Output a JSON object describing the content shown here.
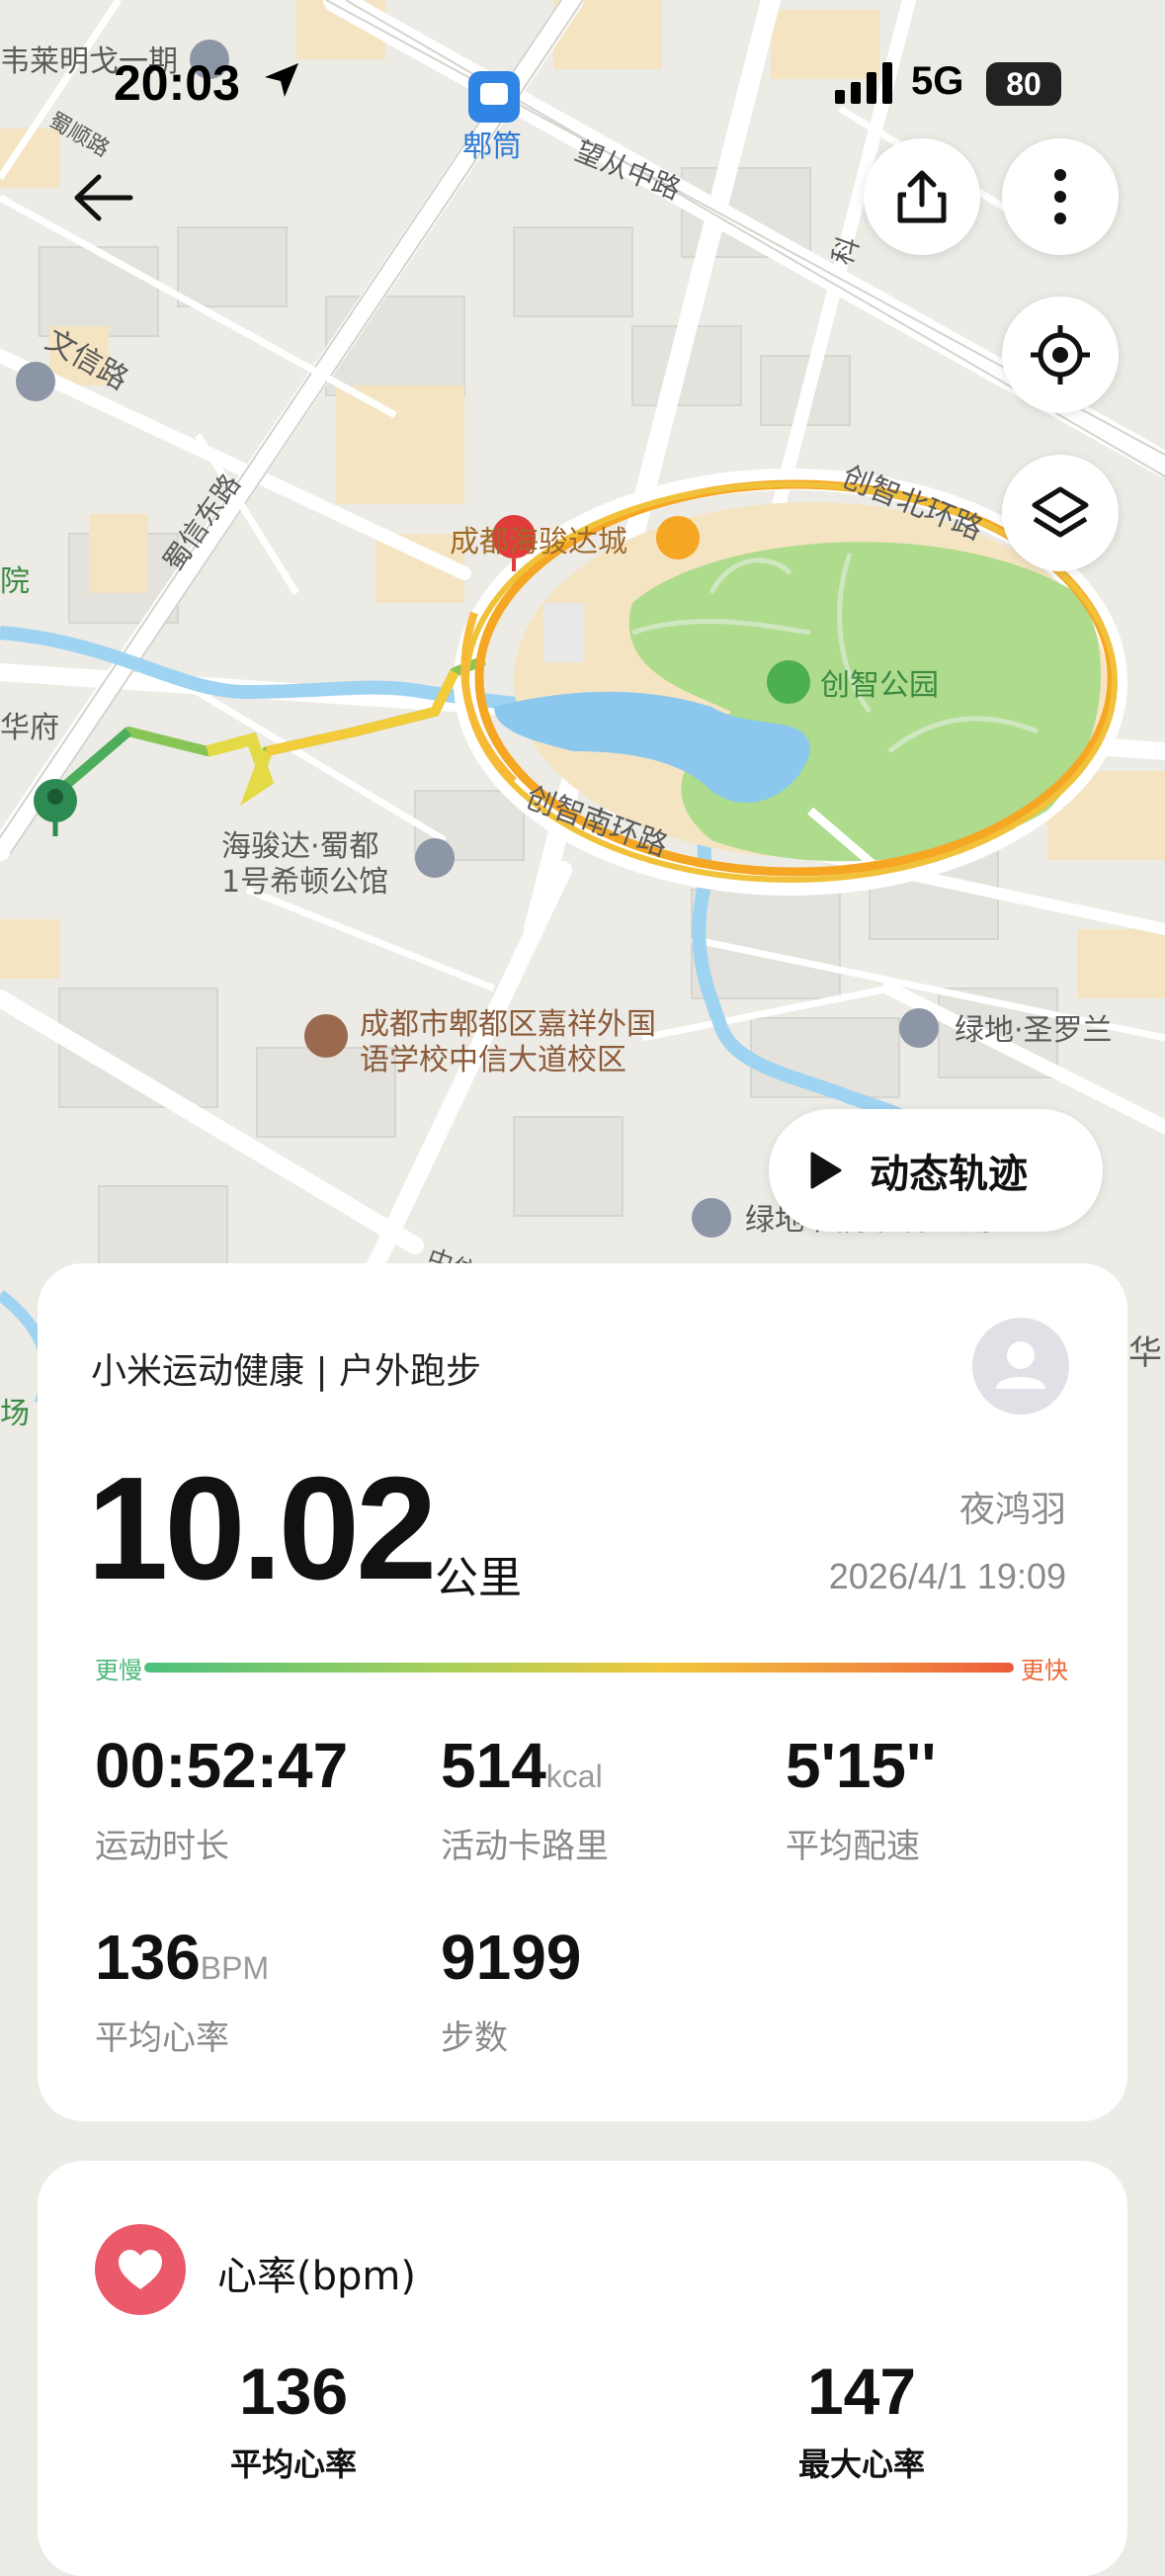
{
  "status_bar": {
    "time": "20:03",
    "network": "5G",
    "battery": "80"
  },
  "map": {
    "labels": {
      "top_left": "韦莱明戈一期",
      "metro": "郫筒",
      "road_wangcong": "望从中路",
      "road_shuxun": "蜀顺路",
      "road_wenxin": "文信路",
      "road_shuxindong": "蜀信东路",
      "road_chuangzhi_north": "创智北环路",
      "road_chuangzhi_south": "创智南环路",
      "road_keji": "科",
      "mall": "成都海骏达城",
      "park": "创智公园",
      "left_hua": "华府",
      "left_yuan": "院",
      "apartment_1": "海骏达·蜀都",
      "apartment_2": "1号希顿公馆",
      "school_1": "成都市郫都区嘉祥外国",
      "school_2": "语学校中信大道校区",
      "greenland_1": "绿地·圣罗兰",
      "greenland_2": "绿地·国际花都二期",
      "right_hua": "华",
      "left_chang": "场",
      "road_zhong": "中信"
    }
  },
  "buttons": {
    "dynamic_track": "动态轨迹"
  },
  "summary": {
    "app_title": "小米运动健康 | 户外跑步",
    "user_name": "夜鸿羽",
    "datetime": "2026/4/1 19:09",
    "distance": "10.02",
    "distance_unit": "公里",
    "pace_slow": "更慢",
    "pace_fast": "更快",
    "duration": "00:52:47",
    "duration_label": "运动时长",
    "calories": "514",
    "calories_unit": "kcal",
    "calories_label": "活动卡路里",
    "avg_pace": "5'15''",
    "avg_pace_label": "平均配速",
    "avg_hr": "136",
    "avg_hr_unit": "BPM",
    "avg_hr_label": "平均心率",
    "steps": "9199",
    "steps_label": "步数"
  },
  "heart_rate": {
    "title": "心率(bpm)",
    "avg_value": "136",
    "avg_label": "平均心率",
    "max_value": "147",
    "max_label": "最大心率"
  },
  "colors": {
    "route_green": "#4cae5c",
    "route_yellow": "#f2cc3a",
    "route_orange": "#f5a623",
    "park_green": "#a9d88a",
    "heart_red": "#ea5a6a"
  }
}
